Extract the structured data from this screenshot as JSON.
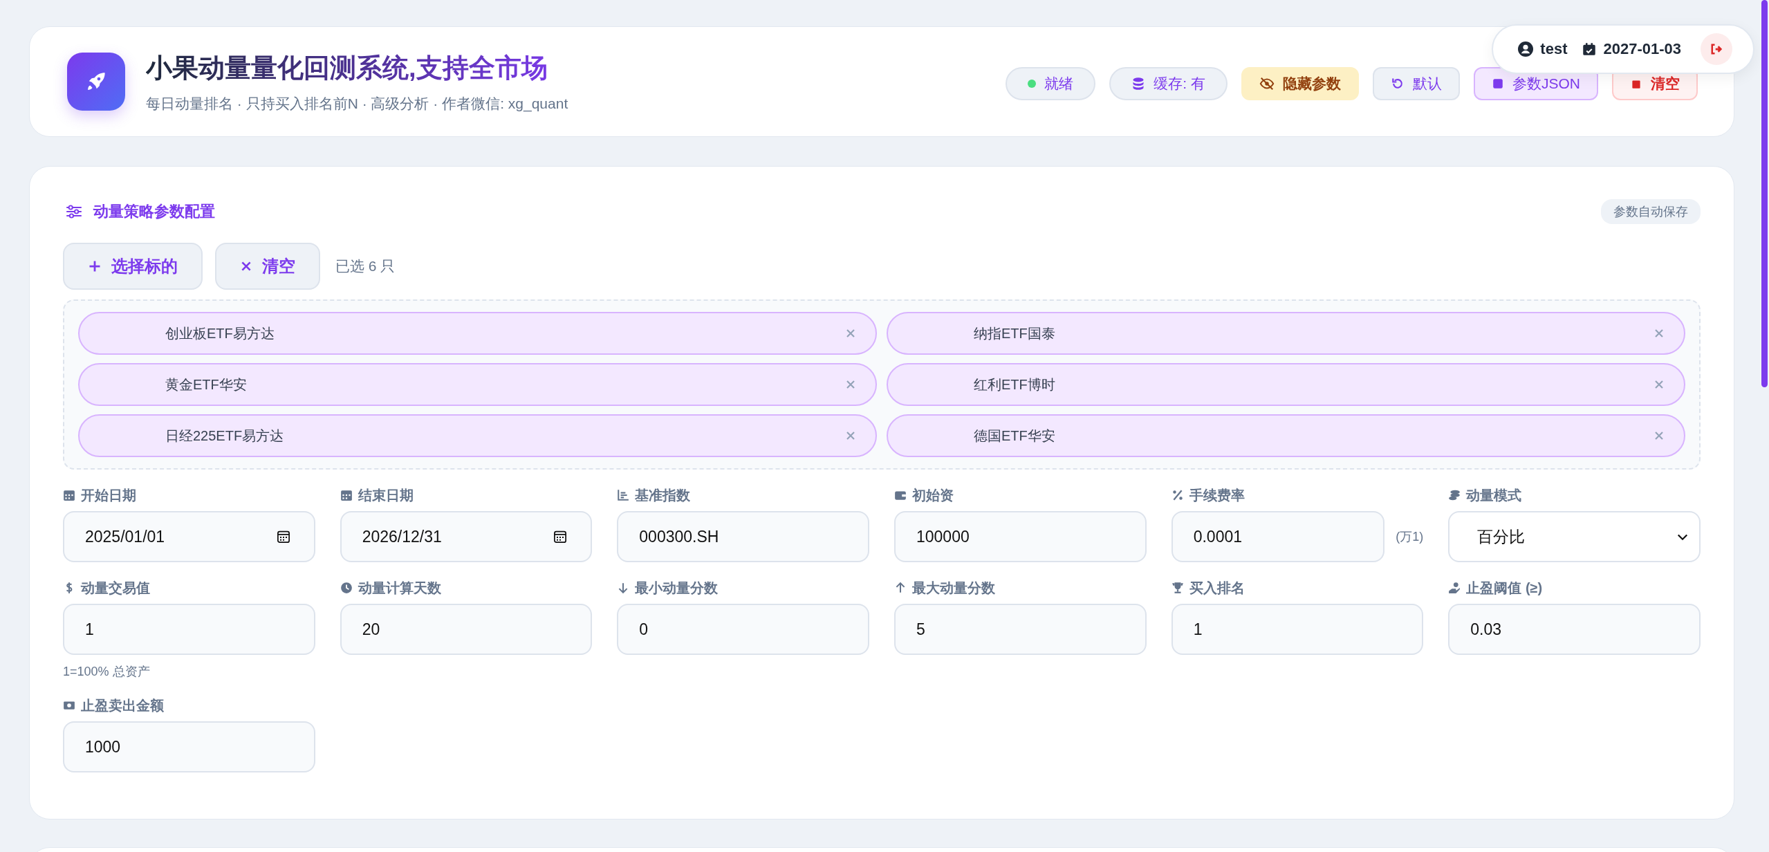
{
  "header": {
    "title": "小果动量量化回测系统,支持全市场",
    "subtitle": "每日动量排名 · 只持买入排名前N · 高级分析 · 作者微信: xg_quant",
    "buttons": [
      {
        "kind": "status",
        "label": "就绪"
      },
      {
        "kind": "cache",
        "label": "缓存: 有"
      },
      {
        "kind": "warning",
        "label": "隐藏参数"
      },
      {
        "kind": "default",
        "label": "默认"
      },
      {
        "kind": "json",
        "label": "参数JSON"
      },
      {
        "kind": "danger",
        "label": "清空"
      }
    ]
  },
  "user_popup": {
    "user": "test",
    "date": "2027-01-03"
  },
  "config": {
    "title": "动量策略参数配置",
    "autosave_badge": "参数自动保存",
    "buttons": [
      {
        "kind": "add",
        "label": "选择标的"
      },
      {
        "kind": "clear",
        "label": "清空"
      }
    ],
    "selected_count": "已选 6 只",
    "chips": [
      {
        "name": "创业板ETF易方达"
      },
      {
        "name": "纳指ETF国泰"
      },
      {
        "name": "黄金ETF华安"
      },
      {
        "name": "红利ETF博时"
      },
      {
        "name": "日经225ETF易方达"
      },
      {
        "name": "德国ETF华安"
      }
    ],
    "fields": [
      {
        "kind": "date",
        "label": "开始日期",
        "value": "2025/01/01"
      },
      {
        "kind": "date",
        "label": "结束日期",
        "value": "2026/12/31"
      },
      {
        "kind": "text",
        "label": "基准指数",
        "value": "000300.SH"
      },
      {
        "kind": "text",
        "label": "初始资",
        "value": "100000"
      },
      {
        "kind": "text",
        "label": "手续费率",
        "value": "0.0001",
        "suffix": "(万1)"
      },
      {
        "kind": "select",
        "label": "动量模式",
        "value": "百分比"
      },
      {
        "kind": "text",
        "label": "动量交易值",
        "value": "1",
        "hint": "1=100% 总资产"
      },
      {
        "kind": "text",
        "label": "动量计算天数",
        "value": "20"
      },
      {
        "kind": "text",
        "label": "最小动量分数",
        "value": "0"
      },
      {
        "kind": "text",
        "label": "最大动量分数",
        "value": "5"
      },
      {
        "kind": "text",
        "label": "买入排名",
        "value": "1"
      },
      {
        "kind": "text",
        "label": "止盈阈值 (≥)",
        "value": "0.03"
      },
      {
        "kind": "text",
        "label": "止盈卖出金额",
        "value": "1000"
      }
    ]
  }
}
